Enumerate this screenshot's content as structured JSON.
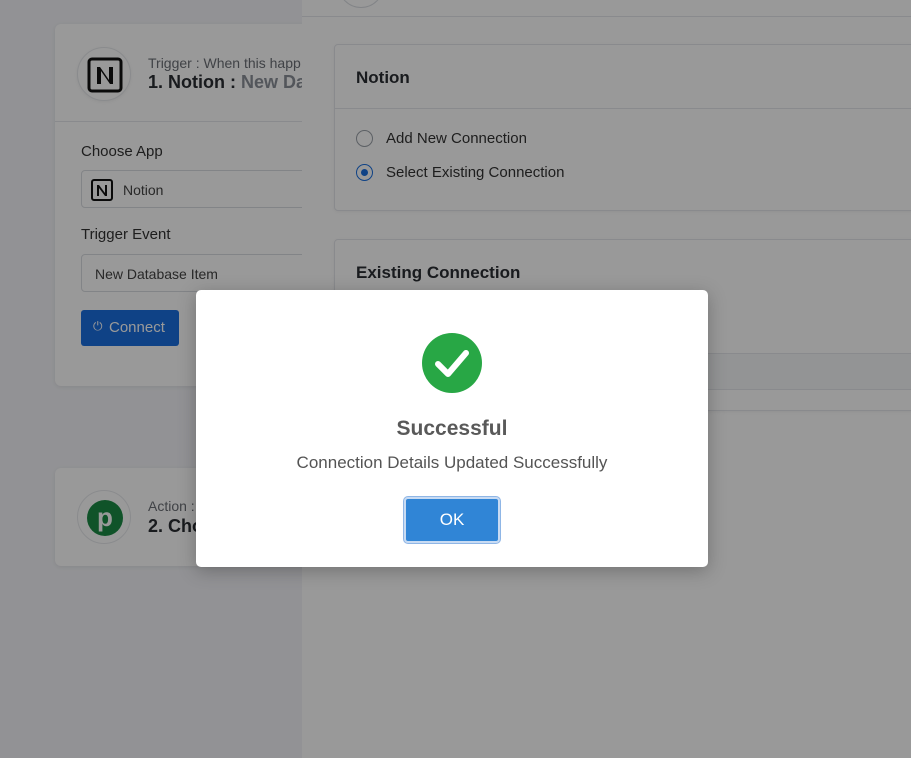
{
  "colors": {
    "accent": "#1a6fe0",
    "success": "#28a745",
    "ok_button": "#3085d6",
    "overlay": "rgba(0,0,0,0.4)"
  },
  "trigger_card": {
    "subtitle": "Trigger : When this happ",
    "title_number": "1. Notion : ",
    "title_event": "New Dat",
    "choose_app_label": "Choose App",
    "choose_app_value": "Notion",
    "trigger_event_label": "Trigger Event",
    "trigger_event_value": "New Database Item",
    "connect_label": "Connect",
    "connect_icon": "plug-icon"
  },
  "action_card": {
    "subtitle": "Action :",
    "title": "2. Cho",
    "logo_letter": "p"
  },
  "notion_section": {
    "title": "Notion",
    "options": [
      {
        "label": "Add New Connection",
        "checked": false
      },
      {
        "label": "Select Existing Connection",
        "checked": true
      }
    ]
  },
  "existing_section": {
    "title": "Existing Connection"
  },
  "modal": {
    "icon": "check-circle-icon",
    "title": "Successful",
    "message": "Connection Details Updated Successfully",
    "ok_label": "OK"
  }
}
